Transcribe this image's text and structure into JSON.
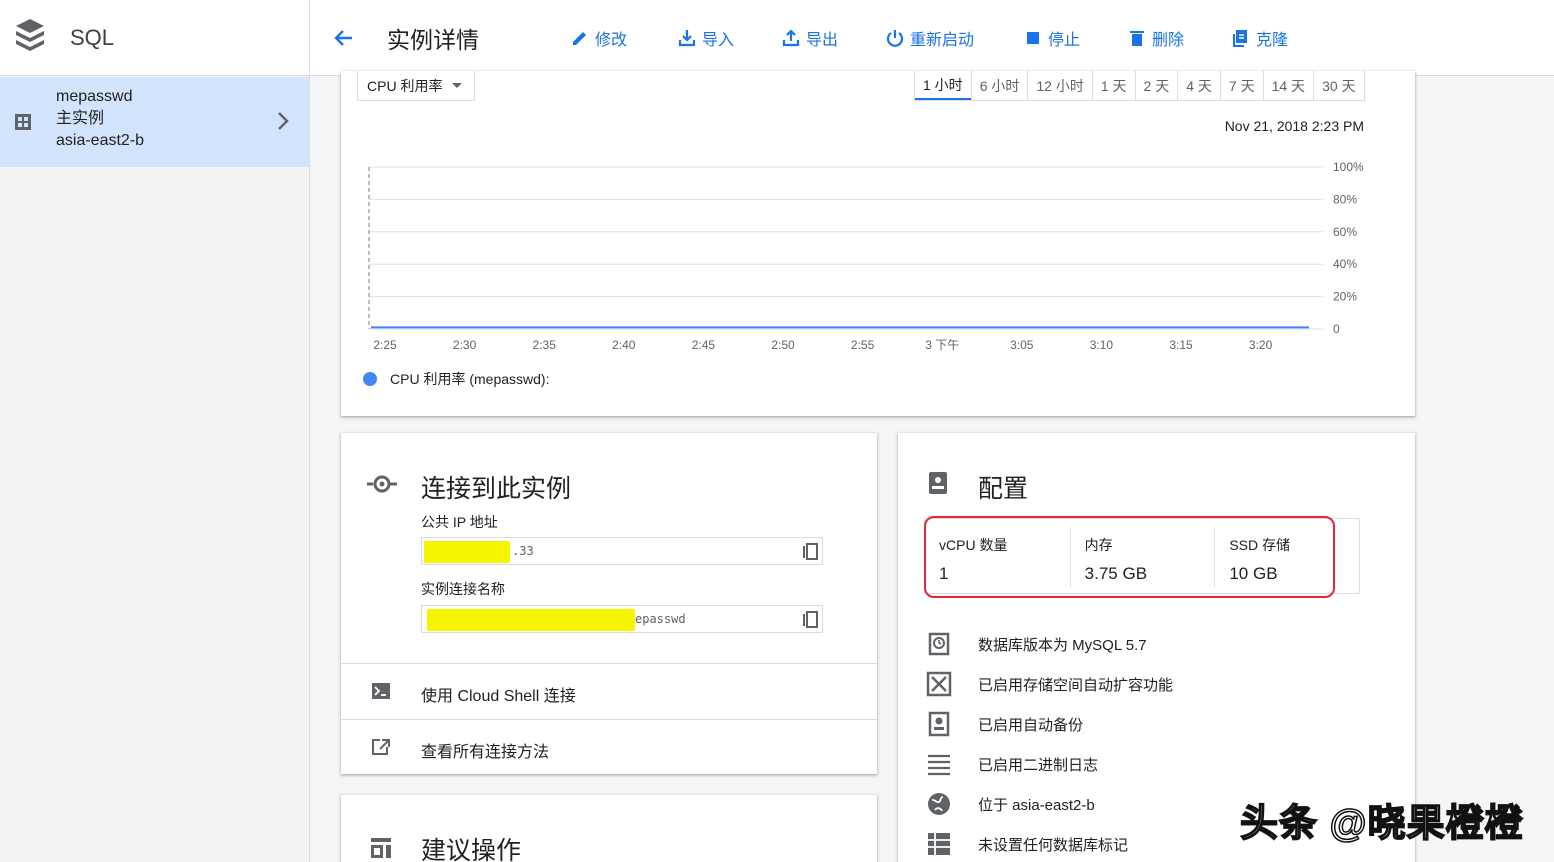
{
  "app": {
    "title": "SQL"
  },
  "sidebar": {
    "instance": {
      "name": "mepasswd",
      "role": "主实例",
      "zone": "asia-east2-b"
    }
  },
  "header": {
    "title": "实例详情",
    "actions": [
      {
        "label": "修改",
        "icon": "edit-icon"
      },
      {
        "label": "导入",
        "icon": "import-icon"
      },
      {
        "label": "导出",
        "icon": "export-icon"
      },
      {
        "label": "重新启动",
        "icon": "restart-icon"
      },
      {
        "label": "停止",
        "icon": "stop-icon"
      },
      {
        "label": "删除",
        "icon": "delete-icon"
      },
      {
        "label": "克隆",
        "icon": "clone-icon"
      }
    ]
  },
  "metric": {
    "selected": "CPU 利用率"
  },
  "ranges": [
    "1 小时",
    "6 小时",
    "12 小时",
    "1 天",
    "2 天",
    "4 天",
    "7 天",
    "14 天",
    "30 天"
  ],
  "chart_data": {
    "type": "line",
    "timestamp": "Nov 21, 2018 2:23 PM",
    "x": [
      "2:25",
      "2:30",
      "2:35",
      "2:40",
      "2:45",
      "2:50",
      "2:55",
      "3 下午",
      "3:05",
      "3:10",
      "3:15",
      "3:20"
    ],
    "y_ticks": [
      "100%",
      "80%",
      "60%",
      "40%",
      "20%",
      "0"
    ],
    "ylim": [
      0,
      100
    ],
    "grid": true,
    "series": [
      {
        "name": "CPU 利用率 (mepasswd):",
        "color": "#4285f4",
        "values": [
          1,
          1,
          1,
          1,
          1,
          1,
          1,
          1,
          1,
          1,
          1,
          1
        ]
      }
    ]
  },
  "connect": {
    "title": "连接到此实例",
    "public_ip_label": "公共 IP 地址",
    "public_ip_value": ".33",
    "conn_name_label": "实例连接名称",
    "conn_name_value": "epasswd",
    "cloud_shell": "使用 Cloud Shell 连接",
    "all_methods": "查看所有连接方法"
  },
  "suggest": {
    "title": "建议操作"
  },
  "config": {
    "title": "配置",
    "specs": [
      {
        "label": "vCPU 数量",
        "value": "1"
      },
      {
        "label": "内存",
        "value": "3.75 GB"
      },
      {
        "label": "SSD 存储",
        "value": "10 GB"
      }
    ],
    "features": [
      {
        "text": "数据库版本为 MySQL 5.7",
        "icon": "database-version-icon"
      },
      {
        "text": "已启用存储空间自动扩容功能",
        "icon": "auto-resize-icon"
      },
      {
        "text": "已启用自动备份",
        "icon": "backup-icon"
      },
      {
        "text": "已启用二进制日志",
        "icon": "binary-log-icon"
      },
      {
        "text": "位于 asia-east2-b",
        "icon": "globe-icon"
      },
      {
        "text": "未设置任何数据库标记",
        "icon": "flags-icon"
      }
    ]
  },
  "watermark": "头条 @晓果橙橙"
}
